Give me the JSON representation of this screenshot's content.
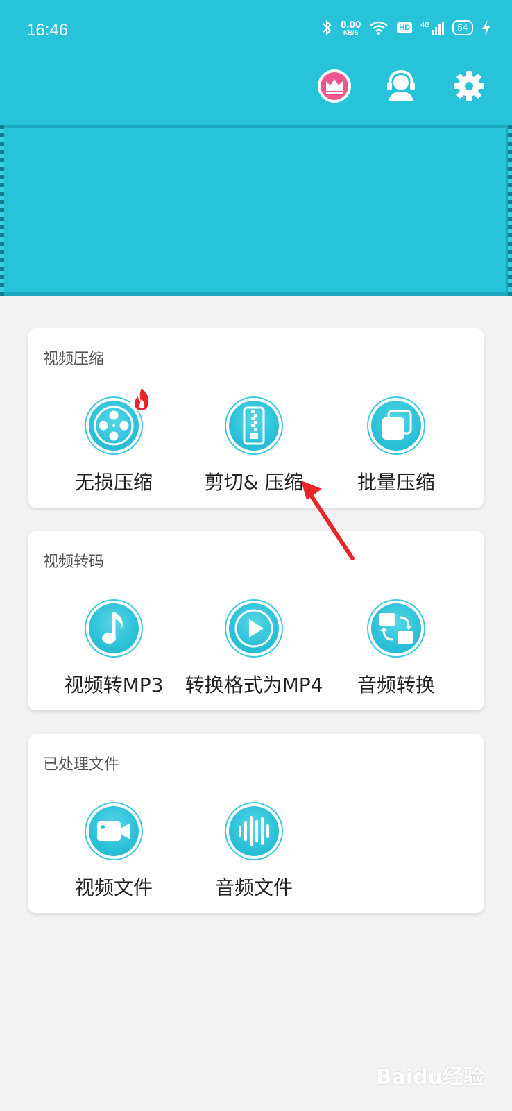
{
  "status_bar": {
    "time": "16:46",
    "net_speed_value": "8.00",
    "net_speed_unit": "KB/S",
    "hd": "HD",
    "network": "4G",
    "battery": "54"
  },
  "toolbar": {
    "icons": [
      "crown-icon",
      "customer-service-icon",
      "gear-icon"
    ]
  },
  "sections": [
    {
      "title": "视频压缩",
      "items": [
        {
          "label": "无损压缩",
          "icon": "film-reel-icon",
          "badge": "fire-icon"
        },
        {
          "label": "剪切& 压缩",
          "icon": "zip-icon"
        },
        {
          "label": "批量压缩",
          "icon": "stack-icon"
        }
      ]
    },
    {
      "title": "视频转码",
      "items": [
        {
          "label": "视频转MP3",
          "icon": "music-note-icon"
        },
        {
          "label": "转换格式为MP4",
          "icon": "play-icon"
        },
        {
          "label": "音频转换",
          "icon": "convert-icon"
        }
      ]
    },
    {
      "title": "已处理文件",
      "items": [
        {
          "label": "视频文件",
          "icon": "video-camera-icon"
        },
        {
          "label": "音频文件",
          "icon": "waveform-icon"
        }
      ]
    }
  ],
  "watermark": "Baidu经验",
  "colors": {
    "primary": "#27c3da",
    "background": "#f2f2f2",
    "arrow": "#e8262a"
  }
}
